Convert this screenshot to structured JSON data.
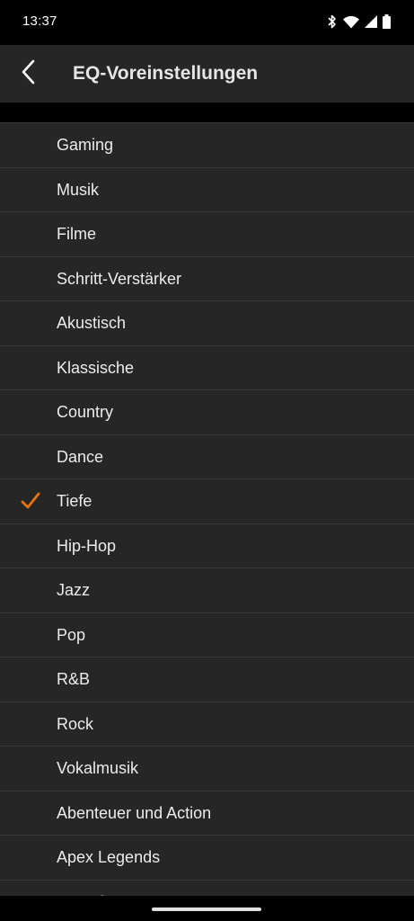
{
  "status_bar": {
    "time": "13:37",
    "icons": [
      "bluetooth-icon",
      "wifi-icon",
      "signal-icon",
      "battery-icon"
    ]
  },
  "header": {
    "back_icon": "chevron-left-icon",
    "title": "EQ-Voreinstellungen"
  },
  "presets": {
    "selected": "Tiefe",
    "check_color": "#e8740f",
    "items": [
      {
        "label": "Gaming"
      },
      {
        "label": "Musik"
      },
      {
        "label": "Filme"
      },
      {
        "label": "Schritt-Verstärker"
      },
      {
        "label": "Akustisch"
      },
      {
        "label": "Klassische"
      },
      {
        "label": "Country"
      },
      {
        "label": "Dance"
      },
      {
        "label": "Tiefe"
      },
      {
        "label": "Hip-Hop"
      },
      {
        "label": "Jazz"
      },
      {
        "label": "Pop"
      },
      {
        "label": "R&B"
      },
      {
        "label": "Rock"
      },
      {
        "label": "Vokalmusik"
      },
      {
        "label": "Abenteuer und Action"
      },
      {
        "label": "Apex Legends"
      },
      {
        "label": "Age of Wo..."
      }
    ]
  },
  "colors": {
    "background": "#000000",
    "surface": "#262626",
    "divider": "#383838",
    "text": "#ececec",
    "accent": "#e8740f"
  }
}
